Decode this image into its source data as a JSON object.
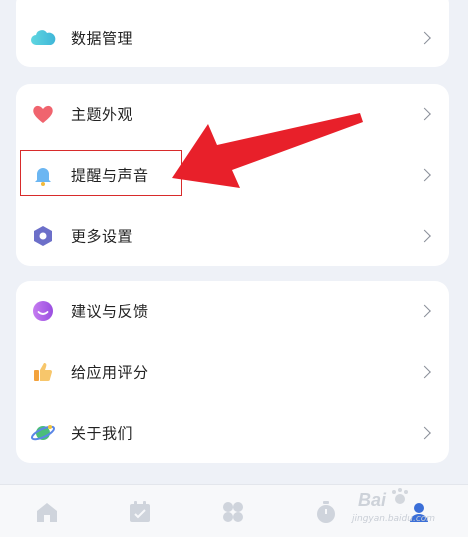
{
  "card1": {
    "items": [
      {
        "label": "数据管理",
        "icon": "cloud-icon"
      }
    ]
  },
  "card2": {
    "items": [
      {
        "label": "主题外观",
        "icon": "heart-icon"
      },
      {
        "label": "提醒与声音",
        "icon": "bell-icon"
      },
      {
        "label": "更多设置",
        "icon": "hexagon-gear-icon"
      }
    ]
  },
  "card3": {
    "items": [
      {
        "label": "建议与反馈",
        "icon": "chat-bubble-icon"
      },
      {
        "label": "给应用评分",
        "icon": "thumbs-up-icon"
      },
      {
        "label": "关于我们",
        "icon": "planet-icon"
      }
    ]
  },
  "tabbar": {
    "tabs": [
      "home-icon",
      "calendar-icon",
      "apps-icon",
      "timer-icon",
      "profile-icon"
    ]
  },
  "watermark": {
    "text": "jingyan.baidu.com"
  },
  "colors": {
    "background": "#eef1f7",
    "highlight": "#d82b2b",
    "arrow": "#e8202a",
    "active_tab": "#3b6fd8"
  }
}
